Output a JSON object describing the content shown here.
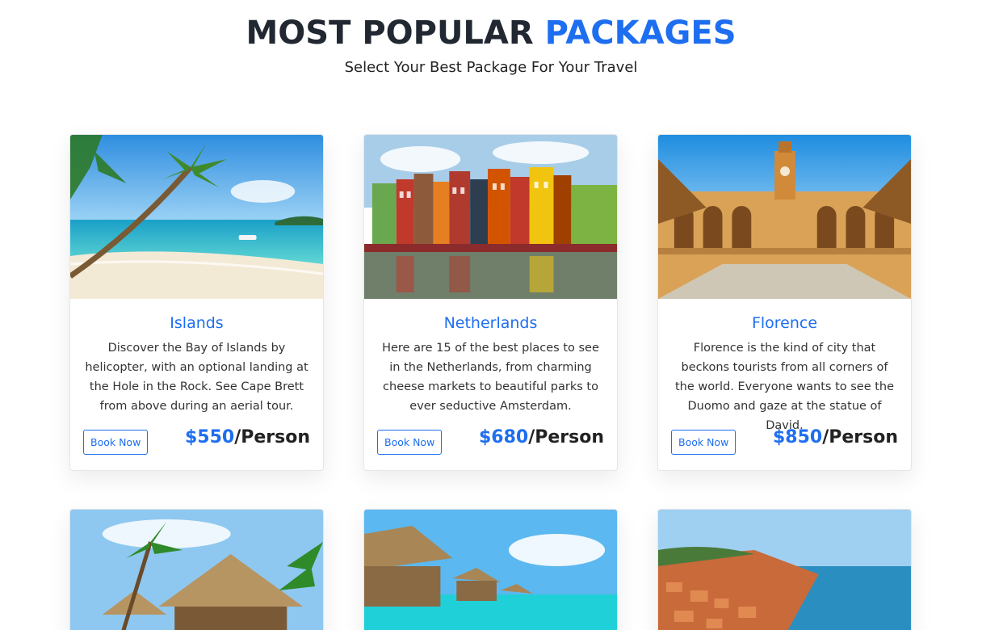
{
  "header": {
    "title_main": "MOST POPULAR",
    "title_accent": "PACKAGES",
    "subtitle": "Select Your Best Package For Your Travel"
  },
  "colors": {
    "accent": "#1e6ef0",
    "dark": "#222831"
  },
  "packages": [
    {
      "name": "Islands",
      "description": "Discover the Bay of Islands by helicopter, with an optional landing at the Hole in the Rock. See Cape Brett from above during an aerial tour.",
      "button": "Book Now",
      "price": "$550",
      "per": "/Person"
    },
    {
      "name": "Netherlands",
      "description": "Here are 15 of the best places to see in the Netherlands, from charming cheese markets to beautiful parks to ever seductive Amsterdam.",
      "button": "Book Now",
      "price": "$680",
      "per": "/Person"
    },
    {
      "name": "Florence",
      "description": "Florence is the kind of city that beckons tourists from all corners of the world. Everyone wants to see the Duomo and gaze at the statue of David.",
      "button": "Book Now",
      "price": "$850",
      "per": "/Person"
    }
  ]
}
